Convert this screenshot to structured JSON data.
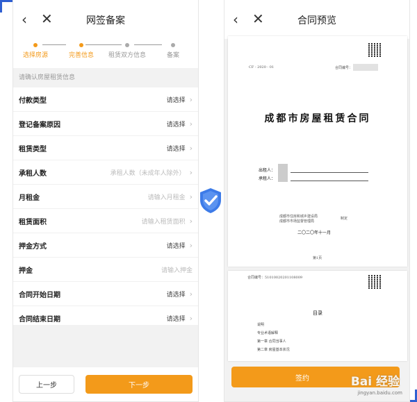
{
  "left": {
    "title": "网签备案",
    "steps": [
      {
        "label": "选择房源",
        "state": "active"
      },
      {
        "label": "完善信息",
        "state": "active"
      },
      {
        "label": "租赁双方信息",
        "state": "todo"
      },
      {
        "label": "备案",
        "state": "todo"
      }
    ],
    "hint": "请确认房屋租赁信息",
    "rows": [
      {
        "key": "付款类型",
        "value": "请选择",
        "placeholder": false,
        "chevron": true
      },
      {
        "key": "登记备案原因",
        "value": "请选择",
        "placeholder": false,
        "chevron": true
      },
      {
        "key": "租赁类型",
        "value": "请选择",
        "placeholder": false,
        "chevron": true
      },
      {
        "key": "承租人数",
        "value": "承租人数（未成年人除外）",
        "placeholder": true,
        "chevron": true
      },
      {
        "key": "月租金",
        "value": "请输入月租金",
        "placeholder": true,
        "chevron": true
      },
      {
        "key": "租赁面积",
        "value": "请输入租赁面积",
        "placeholder": true,
        "chevron": true
      },
      {
        "key": "押金方式",
        "value": "请选择",
        "placeholder": false,
        "chevron": true
      },
      {
        "key": "押金",
        "value": "请输入押金",
        "placeholder": true,
        "chevron": false
      },
      {
        "key": "合同开始日期",
        "value": "请选择",
        "placeholder": false,
        "chevron": true
      },
      {
        "key": "合同结束日期",
        "value": "请选择",
        "placeholder": false,
        "chevron": true
      }
    ],
    "prev_label": "上一步",
    "next_label": "下一步"
  },
  "right": {
    "title": "合同预览",
    "doc1": {
      "code_left": "CF - 2020 - 01",
      "code_right": "合同编号：",
      "title": "成都市房屋租赁合同",
      "lessor_label": "出租人：",
      "lessee_label": "承租人：",
      "issuer_line1": "成都市住房和城乡建设局",
      "issuer_line2": "成都市市场监督管理局",
      "issuer_suffix": "制定",
      "date": "二〇二〇年十一月",
      "page": "第1页"
    },
    "doc2": {
      "header": "合同编号：51010020201108009",
      "toc_title": "目录",
      "toc": [
        "说明",
        "专业术语解释",
        "第一章 合同当事人",
        "第二章 房屋基本状况"
      ]
    },
    "sign_label": "签约",
    "watermark": "Bai 经验",
    "watermark_sub": "jingyan.baidu.com"
  },
  "icons": {
    "back": "chevron-left",
    "close": "close",
    "shield": "shield-check-icon"
  },
  "colors": {
    "accent": "#f39a1a",
    "shield": "#3d7be8",
    "corner": "#2f5fd1"
  }
}
